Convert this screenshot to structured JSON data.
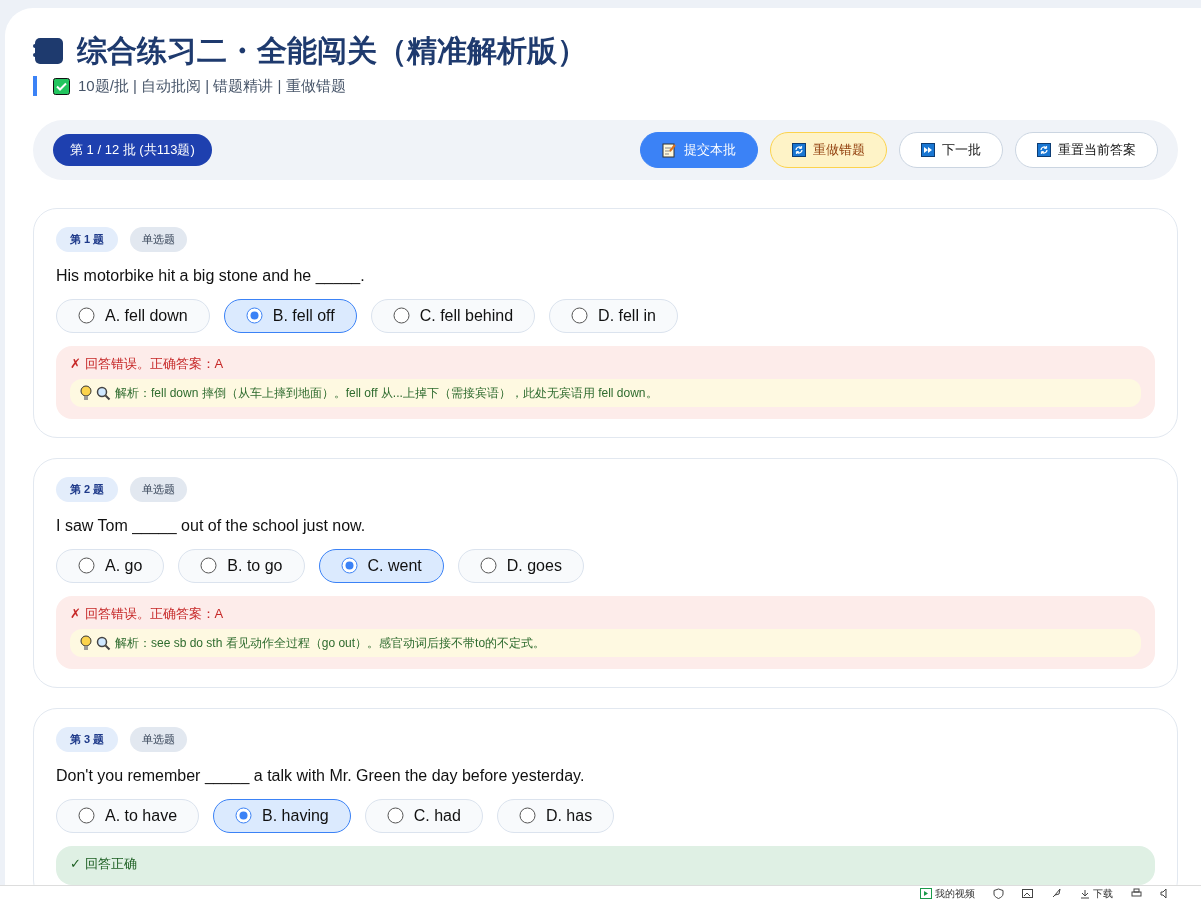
{
  "header": {
    "title": "综合练习二・全能闯关（精准解析版）",
    "subtitle": "10题/批 | 自动批阅 | 错题精讲 | 重做错题"
  },
  "toolbar": {
    "batch": "第 1 / 12 批 (共113题)",
    "buttons": [
      {
        "kind": "submit",
        "label": "提交本批"
      },
      {
        "kind": "redo",
        "label": "重做错题"
      },
      {
        "kind": "next",
        "label": "下一批"
      },
      {
        "kind": "reset",
        "label": "重置当前答案"
      }
    ]
  },
  "questions": [
    {
      "number": "第 1 题",
      "type": "单选题",
      "stem": "His motorbike hit a big stone and he _____.",
      "options": [
        {
          "label": "A. fell down",
          "selected": false
        },
        {
          "label": "B. fell off",
          "selected": true
        },
        {
          "label": "C. fell behind",
          "selected": false
        },
        {
          "label": "D. fell in",
          "selected": false
        }
      ],
      "feedback": {
        "kind": "wrong",
        "text": "✗ 回答错误。正确答案：A",
        "explanation": "解析：fell down 摔倒（从车上摔到地面）。fell off 从...上掉下（需接宾语），此处无宾语用 fell down。"
      }
    },
    {
      "number": "第 2 题",
      "type": "单选题",
      "stem": "I saw Tom _____ out of the school just now.",
      "options": [
        {
          "label": "A. go",
          "selected": false
        },
        {
          "label": "B. to go",
          "selected": false
        },
        {
          "label": "C. went",
          "selected": true
        },
        {
          "label": "D. goes",
          "selected": false
        }
      ],
      "feedback": {
        "kind": "wrong",
        "text": "✗ 回答错误。正确答案：A",
        "explanation": "解析：see sb do sth 看见动作全过程（go out）。感官动词后接不带to的不定式。"
      }
    },
    {
      "number": "第 3 题",
      "type": "单选题",
      "stem": "Don't you remember _____ a talk with Mr. Green the day before yesterday.",
      "options": [
        {
          "label": "A. to have",
          "selected": false
        },
        {
          "label": "B. having",
          "selected": true
        },
        {
          "label": "C. had",
          "selected": false
        },
        {
          "label": "D. has",
          "selected": false
        }
      ],
      "feedback": {
        "kind": "correct",
        "text": "✓ 回答正确"
      }
    }
  ],
  "browser_bar": {
    "items": [
      "我的视频",
      "下载"
    ]
  }
}
